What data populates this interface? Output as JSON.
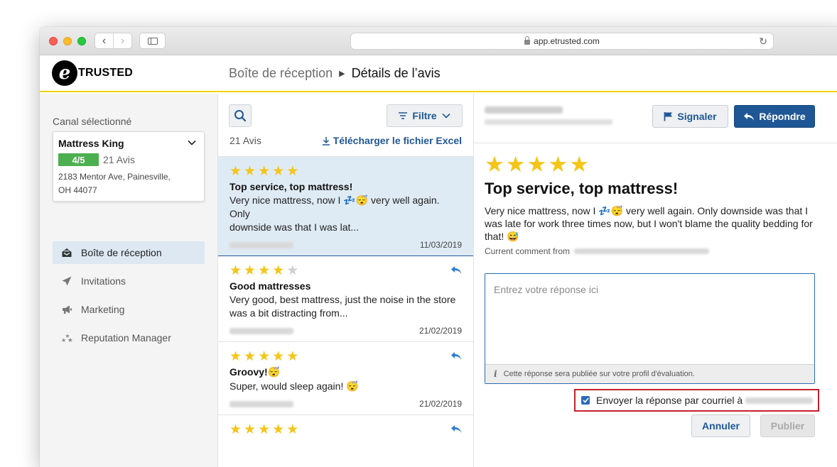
{
  "browser": {
    "url": "app.etrusted.com",
    "back_glyph": "‹",
    "forward_glyph": "›",
    "reload_glyph": "↻"
  },
  "brand": {
    "logo_letter": "e",
    "logo_text": "TRUSTED"
  },
  "breadcrumb": {
    "parent": "Boîte de réception",
    "separator": "▶",
    "current": "Détails de l’avis"
  },
  "sidebar": {
    "channel_label": "Canal sélectionné",
    "channel": {
      "name": "Mattress King",
      "score": "4/5",
      "review_count": "21 Avis",
      "address_line1": "2183 Mentor Ave, Painesville,",
      "address_line2": "OH 44077"
    },
    "items": [
      {
        "label": "Boîte de réception",
        "icon": "inbox-icon",
        "active": true
      },
      {
        "label": "Invitations",
        "icon": "paper-plane-icon",
        "active": false
      },
      {
        "label": "Marketing",
        "icon": "megaphone-icon",
        "active": false
      },
      {
        "label": "Reputation Manager",
        "icon": "sparkle-stars-icon",
        "active": false
      }
    ]
  },
  "list": {
    "filter_label": "Filtre",
    "total_label": "21 Avis",
    "excel_label": "Télécharger le fichier Excel",
    "reviews": [
      {
        "rating": 5,
        "title": "Top service, top mattress!",
        "text_line1": "Very nice mattress, now I 💤😴 very well again. Only",
        "text_line2": "downside was that I was lat...",
        "date": "11/03/2019",
        "selected": true,
        "replied": false
      },
      {
        "rating": 4,
        "title": "Good mattresses",
        "text_line1": "Very good, best mattress, just the noise in the store",
        "text_line2": "was a bit distracting from...",
        "date": "21/02/2019",
        "selected": false,
        "replied": true
      },
      {
        "rating": 5,
        "title": "Groovy!😴",
        "text_line1": "Super, would sleep again! 😴",
        "text_line2": "",
        "date": "21/02/2019",
        "selected": false,
        "replied": true
      },
      {
        "rating": 5,
        "title": "",
        "text_line1": "",
        "text_line2": "",
        "date": "",
        "selected": false,
        "replied": true
      }
    ]
  },
  "detail": {
    "report_label": "Signaler",
    "reply_label": "Répondre",
    "rating": 5,
    "title": "Top service, top mattress!",
    "text_line1": "Very nice mattress, now I 💤😴 very well again. Only downside was that I",
    "text_line2": "was late for work three times now, but I won't blame the quality bedding for",
    "text_line3": "that! 😅",
    "comment_label": "Current comment from",
    "reply_placeholder": "Entrez votre réponse ici",
    "reply_hint_icon": "i",
    "reply_hint": "Cette réponse sera publiée sur votre profil d'évaluation.",
    "email_option_label": "Envoyer la réponse par courriel à",
    "email_option_checked": true,
    "cancel_label": "Annuler",
    "publish_label": "Publier"
  },
  "colors": {
    "accent_blue": "#1f5796",
    "brand_yellow": "#f2d200",
    "star_gold": "#f5c518",
    "score_green": "#4caf50",
    "highlight_red": "#c8202f"
  }
}
